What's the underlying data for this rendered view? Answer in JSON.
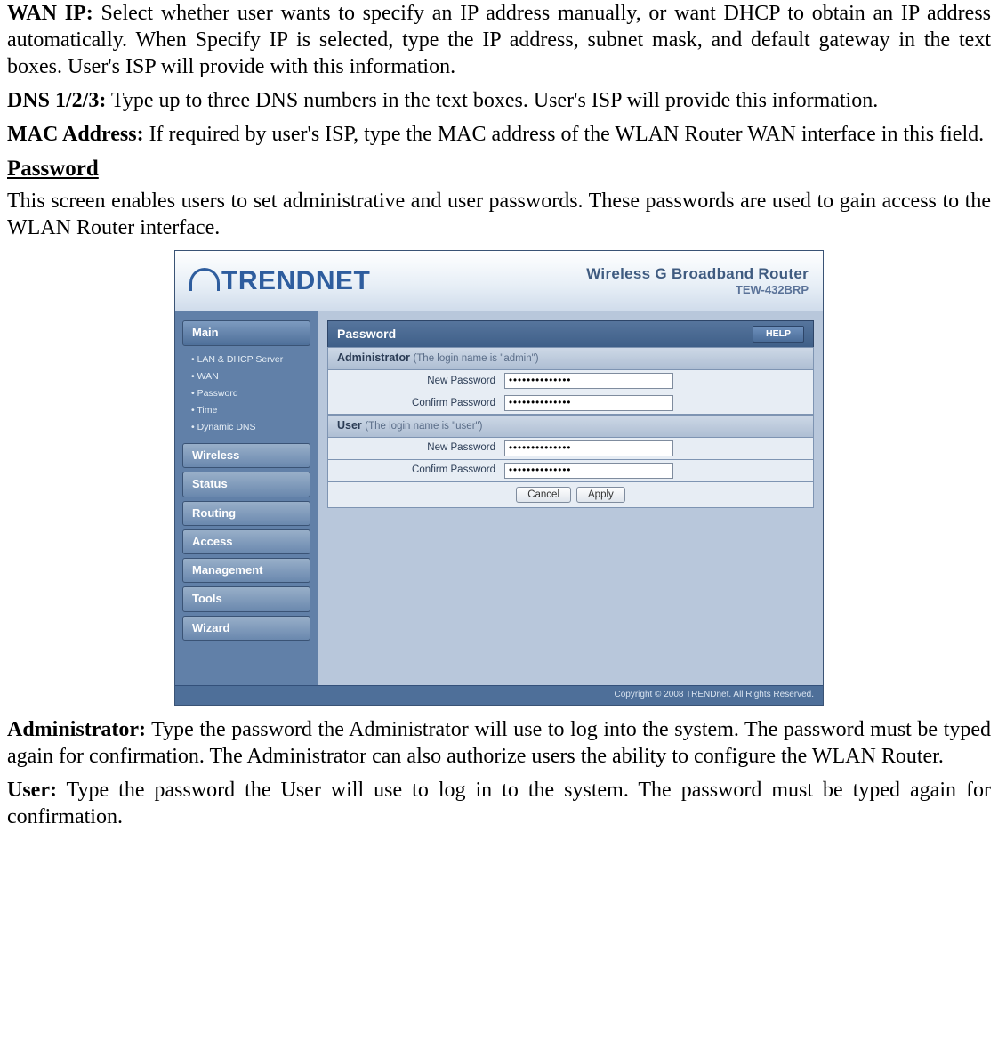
{
  "doc": {
    "wan_ip_label": "WAN IP:",
    "wan_ip_text": " Select whether user wants to specify an IP address manually, or want DHCP to obtain an IP address automatically. When Specify IP is selected, type the IP address, subnet mask, and default gateway in the text boxes. User's ISP will provide with this information.",
    "dns_label": "DNS 1/2/3:",
    "dns_text": " Type up to three DNS numbers in the text boxes. User's ISP will provide this information.",
    "mac_label": "MAC Address:",
    "mac_text": " If required by user's ISP, type the MAC address of the WLAN Router WAN interface in this field.",
    "password_heading": "Password",
    "password_intro": "This screen enables users to set administrative and user passwords. These passwords are used to gain access to the WLAN Router interface.",
    "admin_label": "Administrator:",
    "admin_text": " Type the password the Administrator will use to log into the system. The password must be typed again for confirmation. The Administrator can also authorize users the ability to configure the WLAN Router.",
    "user_label": "User:",
    "user_text": " Type the password the User will use to log in to the system. The password must be typed again for confirmation."
  },
  "router": {
    "brand": "TRENDNET",
    "header_title": "Wireless G Broadband Router",
    "header_model": "TEW-432BRP",
    "nav": {
      "main": "Main",
      "subitems": [
        "LAN & DHCP Server",
        "WAN",
        "Password",
        "Time",
        "Dynamic DNS"
      ],
      "wireless": "Wireless",
      "status": "Status",
      "routing": "Routing",
      "access": "Access",
      "management": "Management",
      "tools": "Tools",
      "wizard": "Wizard"
    },
    "panel": {
      "title": "Password",
      "help": "HELP",
      "admin_label": "Administrator",
      "admin_note": "(The login name is \"admin\")",
      "user_label": "User",
      "user_note": "(The login name is \"user\")",
      "new_pw": "New Password",
      "confirm_pw": "Confirm Password",
      "pw_value": "••••••••••••••",
      "cancel": "Cancel",
      "apply": "Apply"
    },
    "footer": "Copyright © 2008 TRENDnet. All Rights Reserved."
  }
}
